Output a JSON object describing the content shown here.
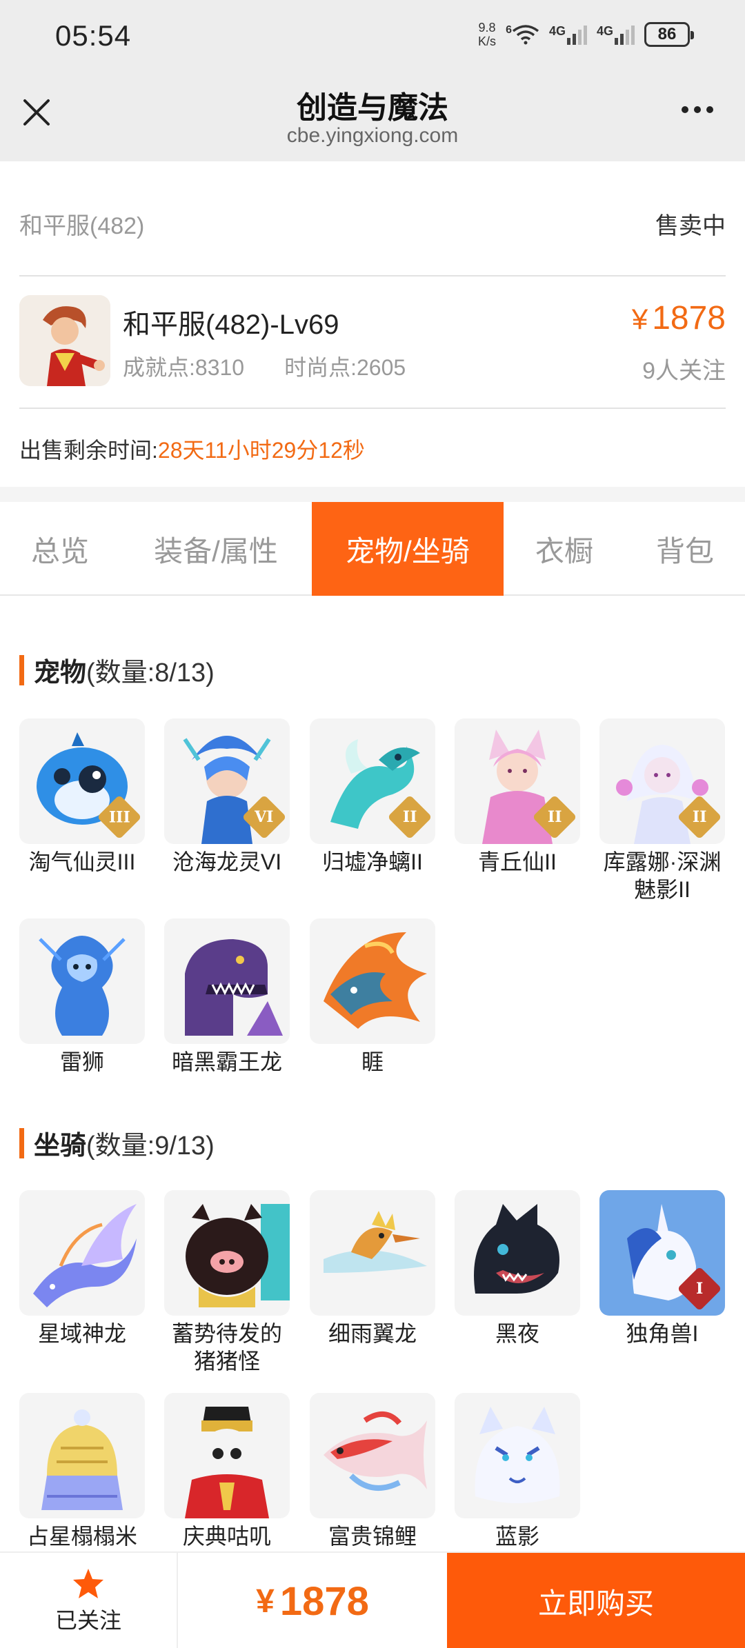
{
  "status_bar": {
    "time": "05:54",
    "net_speed_value": "9.8",
    "net_speed_unit": "K/s",
    "wifi_label": "6",
    "sim1": "4G",
    "sim2": "4G",
    "battery": "86"
  },
  "header": {
    "title": "创造与魔法",
    "url": "cbe.yingxiong.com"
  },
  "listing": {
    "server": "和平服(482)",
    "status": "售卖中",
    "character_name": "和平服(482)-Lv69",
    "achievement": "成就点:8310",
    "fashion": "时尚点:2605",
    "currency": "¥",
    "price": "1878",
    "followers": "9人关注",
    "remaining_label": "出售剩余时间:",
    "remaining_value": "28天11小时29分12秒"
  },
  "tabs": [
    {
      "label": "总览"
    },
    {
      "label": "装备/属性"
    },
    {
      "label": "宠物/坐骑"
    },
    {
      "label": "衣橱"
    },
    {
      "label": "背包"
    }
  ],
  "active_tab": "宠物/坐骑",
  "pets": {
    "title": "宠物",
    "count": "(数量:8/13)",
    "items": [
      {
        "name": "淘气仙灵III",
        "tier": "III",
        "icon": "blue-dog-icon"
      },
      {
        "name": "沧海龙灵VI",
        "tier": "VI",
        "icon": "dragon-spirit-icon"
      },
      {
        "name": "归墟净螭II",
        "tier": "II",
        "icon": "sea-dragon-icon"
      },
      {
        "name": "青丘仙II",
        "tier": "II",
        "icon": "fox-fairy-icon"
      },
      {
        "name": "库露娜·深渊魅影II",
        "tier": "II",
        "icon": "abyss-phantom-icon"
      },
      {
        "name": "雷狮",
        "tier": "",
        "icon": "thunder-lion-icon"
      },
      {
        "name": "暗黑霸王龙",
        "tier": "",
        "icon": "dark-trex-icon"
      },
      {
        "name": "睚",
        "tier": "",
        "icon": "fire-dragon-icon"
      }
    ]
  },
  "mounts": {
    "title": "坐骑",
    "count": "(数量:9/13)",
    "items": [
      {
        "name": "星域神龙",
        "tier": "",
        "icon": "star-dragon-icon"
      },
      {
        "name": "蓄势待发的猪猪怪",
        "tier": "",
        "icon": "pig-monster-icon"
      },
      {
        "name": "细雨翼龙",
        "tier": "",
        "icon": "drizzle-pterosaur-icon"
      },
      {
        "name": "黑夜",
        "tier": "",
        "icon": "black-night-dragon-icon"
      },
      {
        "name": "独角兽I",
        "tier": "I",
        "icon": "unicorn-icon"
      },
      {
        "name": "占星榻榻米",
        "tier": "",
        "icon": "astrology-tatami-icon"
      },
      {
        "name": "庆典咕叽",
        "tier": "",
        "icon": "festival-gugi-icon"
      },
      {
        "name": "富贵锦鲤",
        "tier": "",
        "icon": "koi-fish-icon"
      },
      {
        "name": "蓝影",
        "tier": "",
        "icon": "blue-shadow-tiger-icon"
      }
    ]
  },
  "bottom_bar": {
    "follow_label": "已关注",
    "currency": "¥",
    "price": "1878",
    "buy_label": "立即购买"
  },
  "colors": {
    "accent": "#fe6414",
    "price": "#f26a14",
    "buy_button": "#fe5a0a"
  }
}
